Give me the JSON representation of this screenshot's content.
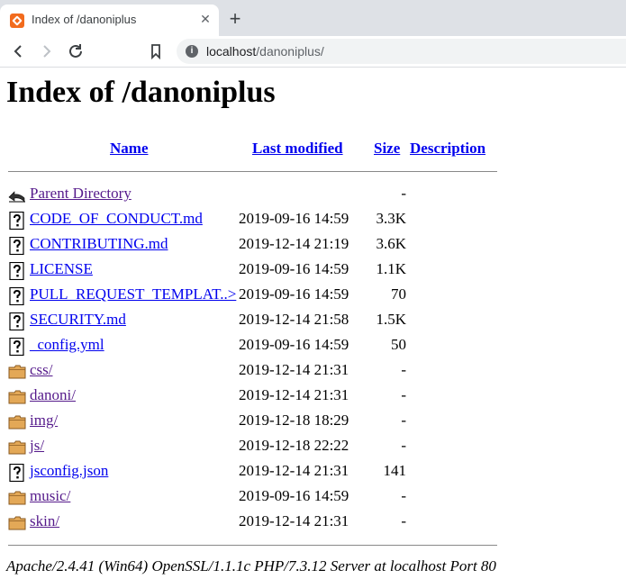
{
  "browser": {
    "tab_title": "Index of /danoniplus",
    "close_glyph": "✕",
    "newtab_glyph": "+",
    "url_host": "localhost",
    "url_path": "/danoniplus/"
  },
  "page": {
    "heading": "Index of /danoniplus",
    "columns": {
      "name": "Name",
      "last_modified": "Last modified",
      "size": "Size",
      "description": "Description"
    },
    "rows": [
      {
        "icon": "back-icon",
        "name": "Parent Directory",
        "date": "",
        "size": "-",
        "visited": true
      },
      {
        "icon": "unknown-file-icon",
        "name": "CODE_OF_CONDUCT.md",
        "date": "2019-09-16 14:59",
        "size": "3.3K",
        "visited": false
      },
      {
        "icon": "unknown-file-icon",
        "name": "CONTRIBUTING.md",
        "date": "2019-12-14 21:19",
        "size": "3.6K",
        "visited": false
      },
      {
        "icon": "unknown-file-icon",
        "name": "LICENSE",
        "date": "2019-09-16 14:59",
        "size": "1.1K",
        "visited": false
      },
      {
        "icon": "unknown-file-icon",
        "name": "PULL_REQUEST_TEMPLAT..>",
        "date": "2019-09-16 14:59",
        "size": "70",
        "visited": false
      },
      {
        "icon": "unknown-file-icon",
        "name": "SECURITY.md",
        "date": "2019-12-14 21:58",
        "size": "1.5K",
        "visited": false
      },
      {
        "icon": "unknown-file-icon",
        "name": "_config.yml",
        "date": "2019-09-16 14:59",
        "size": "50",
        "visited": false
      },
      {
        "icon": "folder-icon",
        "name": "css/",
        "date": "2019-12-14 21:31",
        "size": "-",
        "visited": true
      },
      {
        "icon": "folder-icon",
        "name": "danoni/",
        "date": "2019-12-14 21:31",
        "size": "-",
        "visited": true
      },
      {
        "icon": "folder-icon",
        "name": "img/",
        "date": "2019-12-18 18:29",
        "size": "-",
        "visited": true
      },
      {
        "icon": "folder-icon",
        "name": "js/",
        "date": "2019-12-18 22:22",
        "size": "-",
        "visited": true
      },
      {
        "icon": "unknown-file-icon",
        "name": "jsconfig.json",
        "date": "2019-12-14 21:31",
        "size": "141",
        "visited": false
      },
      {
        "icon": "folder-icon",
        "name": "music/",
        "date": "2019-09-16 14:59",
        "size": "-",
        "visited": true
      },
      {
        "icon": "folder-icon",
        "name": "skin/",
        "date": "2019-12-14 21:31",
        "size": "-",
        "visited": true
      }
    ],
    "server_signature": "Apache/2.4.41 (Win64) OpenSSL/1.1.1c PHP/7.3.12 Server at localhost Port 80"
  },
  "colors": {
    "link": "#0000ee",
    "visited_link": "#551a8b",
    "tabstrip_bg": "#dee1e6",
    "folder_fill": "#e3a857"
  }
}
